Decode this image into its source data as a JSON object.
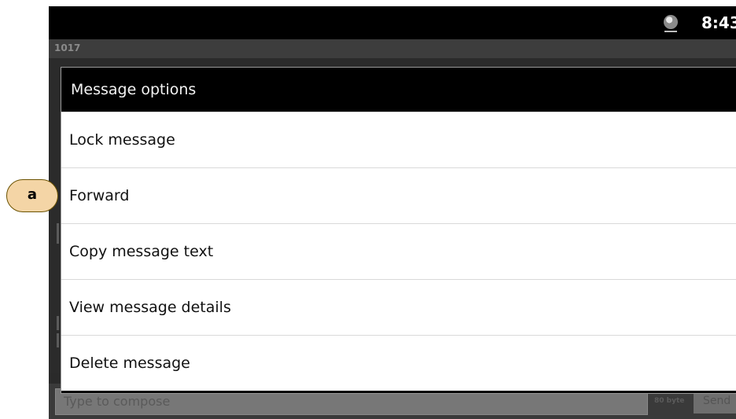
{
  "status_bar": {
    "clock": "8:43"
  },
  "app": {
    "thread_title": "1017"
  },
  "dialog": {
    "title": "Message options",
    "items": [
      {
        "label": "Lock message"
      },
      {
        "label": "Forward"
      },
      {
        "label": "Copy message text"
      },
      {
        "label": "View message details"
      },
      {
        "label": "Delete message"
      }
    ]
  },
  "compose": {
    "placeholder": "Type to compose",
    "byte_counter": "80 byte",
    "send_label": "Send"
  },
  "annotation": {
    "label": "a"
  },
  "colors": {
    "dialog_bg": "#ffffff",
    "title_bg": "#000000",
    "callout_fill": "#f4d5a6"
  }
}
